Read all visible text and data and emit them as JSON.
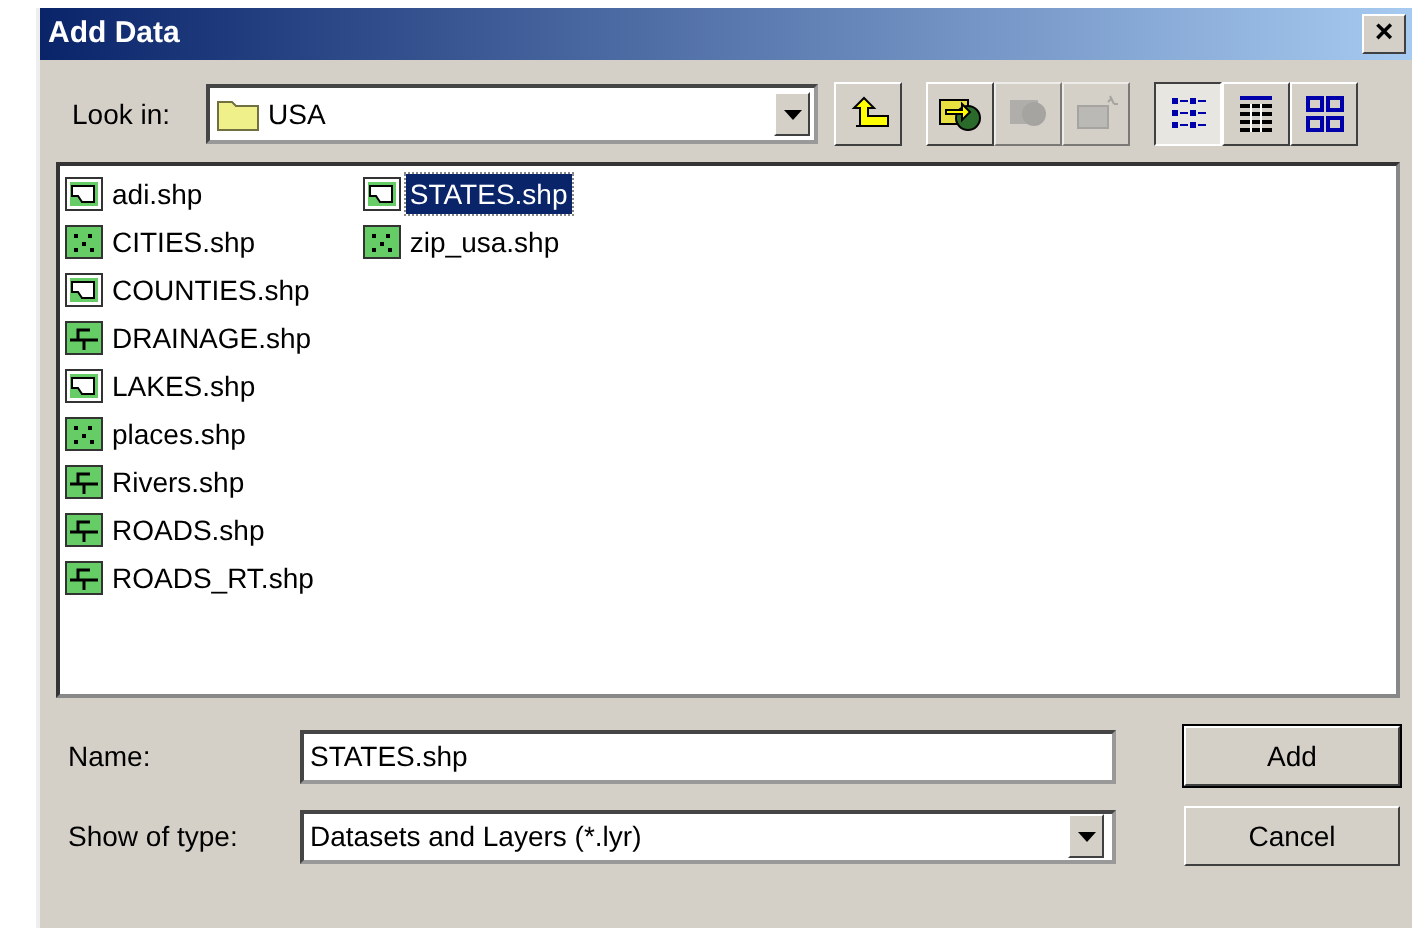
{
  "window": {
    "title": "Add Data",
    "close": "×"
  },
  "look_in": {
    "label": "Look in:",
    "value": "USA"
  },
  "toolbar": [
    {
      "kind": "up",
      "disabled": false,
      "selected": false
    },
    {
      "kind": "connect",
      "disabled": false,
      "selected": false
    },
    {
      "kind": "disconnect",
      "disabled": true,
      "selected": false
    },
    {
      "kind": "newfolder",
      "disabled": true,
      "selected": false
    },
    {
      "kind": "list",
      "disabled": false,
      "selected": true
    },
    {
      "kind": "details",
      "disabled": false,
      "selected": false
    },
    {
      "kind": "thumbnails",
      "disabled": false,
      "selected": false
    }
  ],
  "files": [
    {
      "name": "adi.shp",
      "kind": "polygon",
      "selected": false
    },
    {
      "name": "CITIES.shp",
      "kind": "point",
      "selected": false
    },
    {
      "name": "COUNTIES.shp",
      "kind": "polygon",
      "selected": false
    },
    {
      "name": "DRAINAGE.shp",
      "kind": "line",
      "selected": false
    },
    {
      "name": "LAKES.shp",
      "kind": "polygon",
      "selected": false
    },
    {
      "name": "places.shp",
      "kind": "point",
      "selected": false
    },
    {
      "name": "Rivers.shp",
      "kind": "line",
      "selected": false
    },
    {
      "name": "ROADS.shp",
      "kind": "line",
      "selected": false
    },
    {
      "name": "ROADS_RT.shp",
      "kind": "line",
      "selected": false
    },
    {
      "name": "STATES.shp",
      "kind": "polygon",
      "selected": true
    },
    {
      "name": "zip_usa.shp",
      "kind": "point",
      "selected": false
    }
  ],
  "name_field": {
    "label": "Name:",
    "value": "STATES.shp"
  },
  "type_field": {
    "label": "Show of type:",
    "value": "Datasets and Layers (*.lyr)"
  },
  "buttons": [
    "Add",
    "Cancel"
  ]
}
